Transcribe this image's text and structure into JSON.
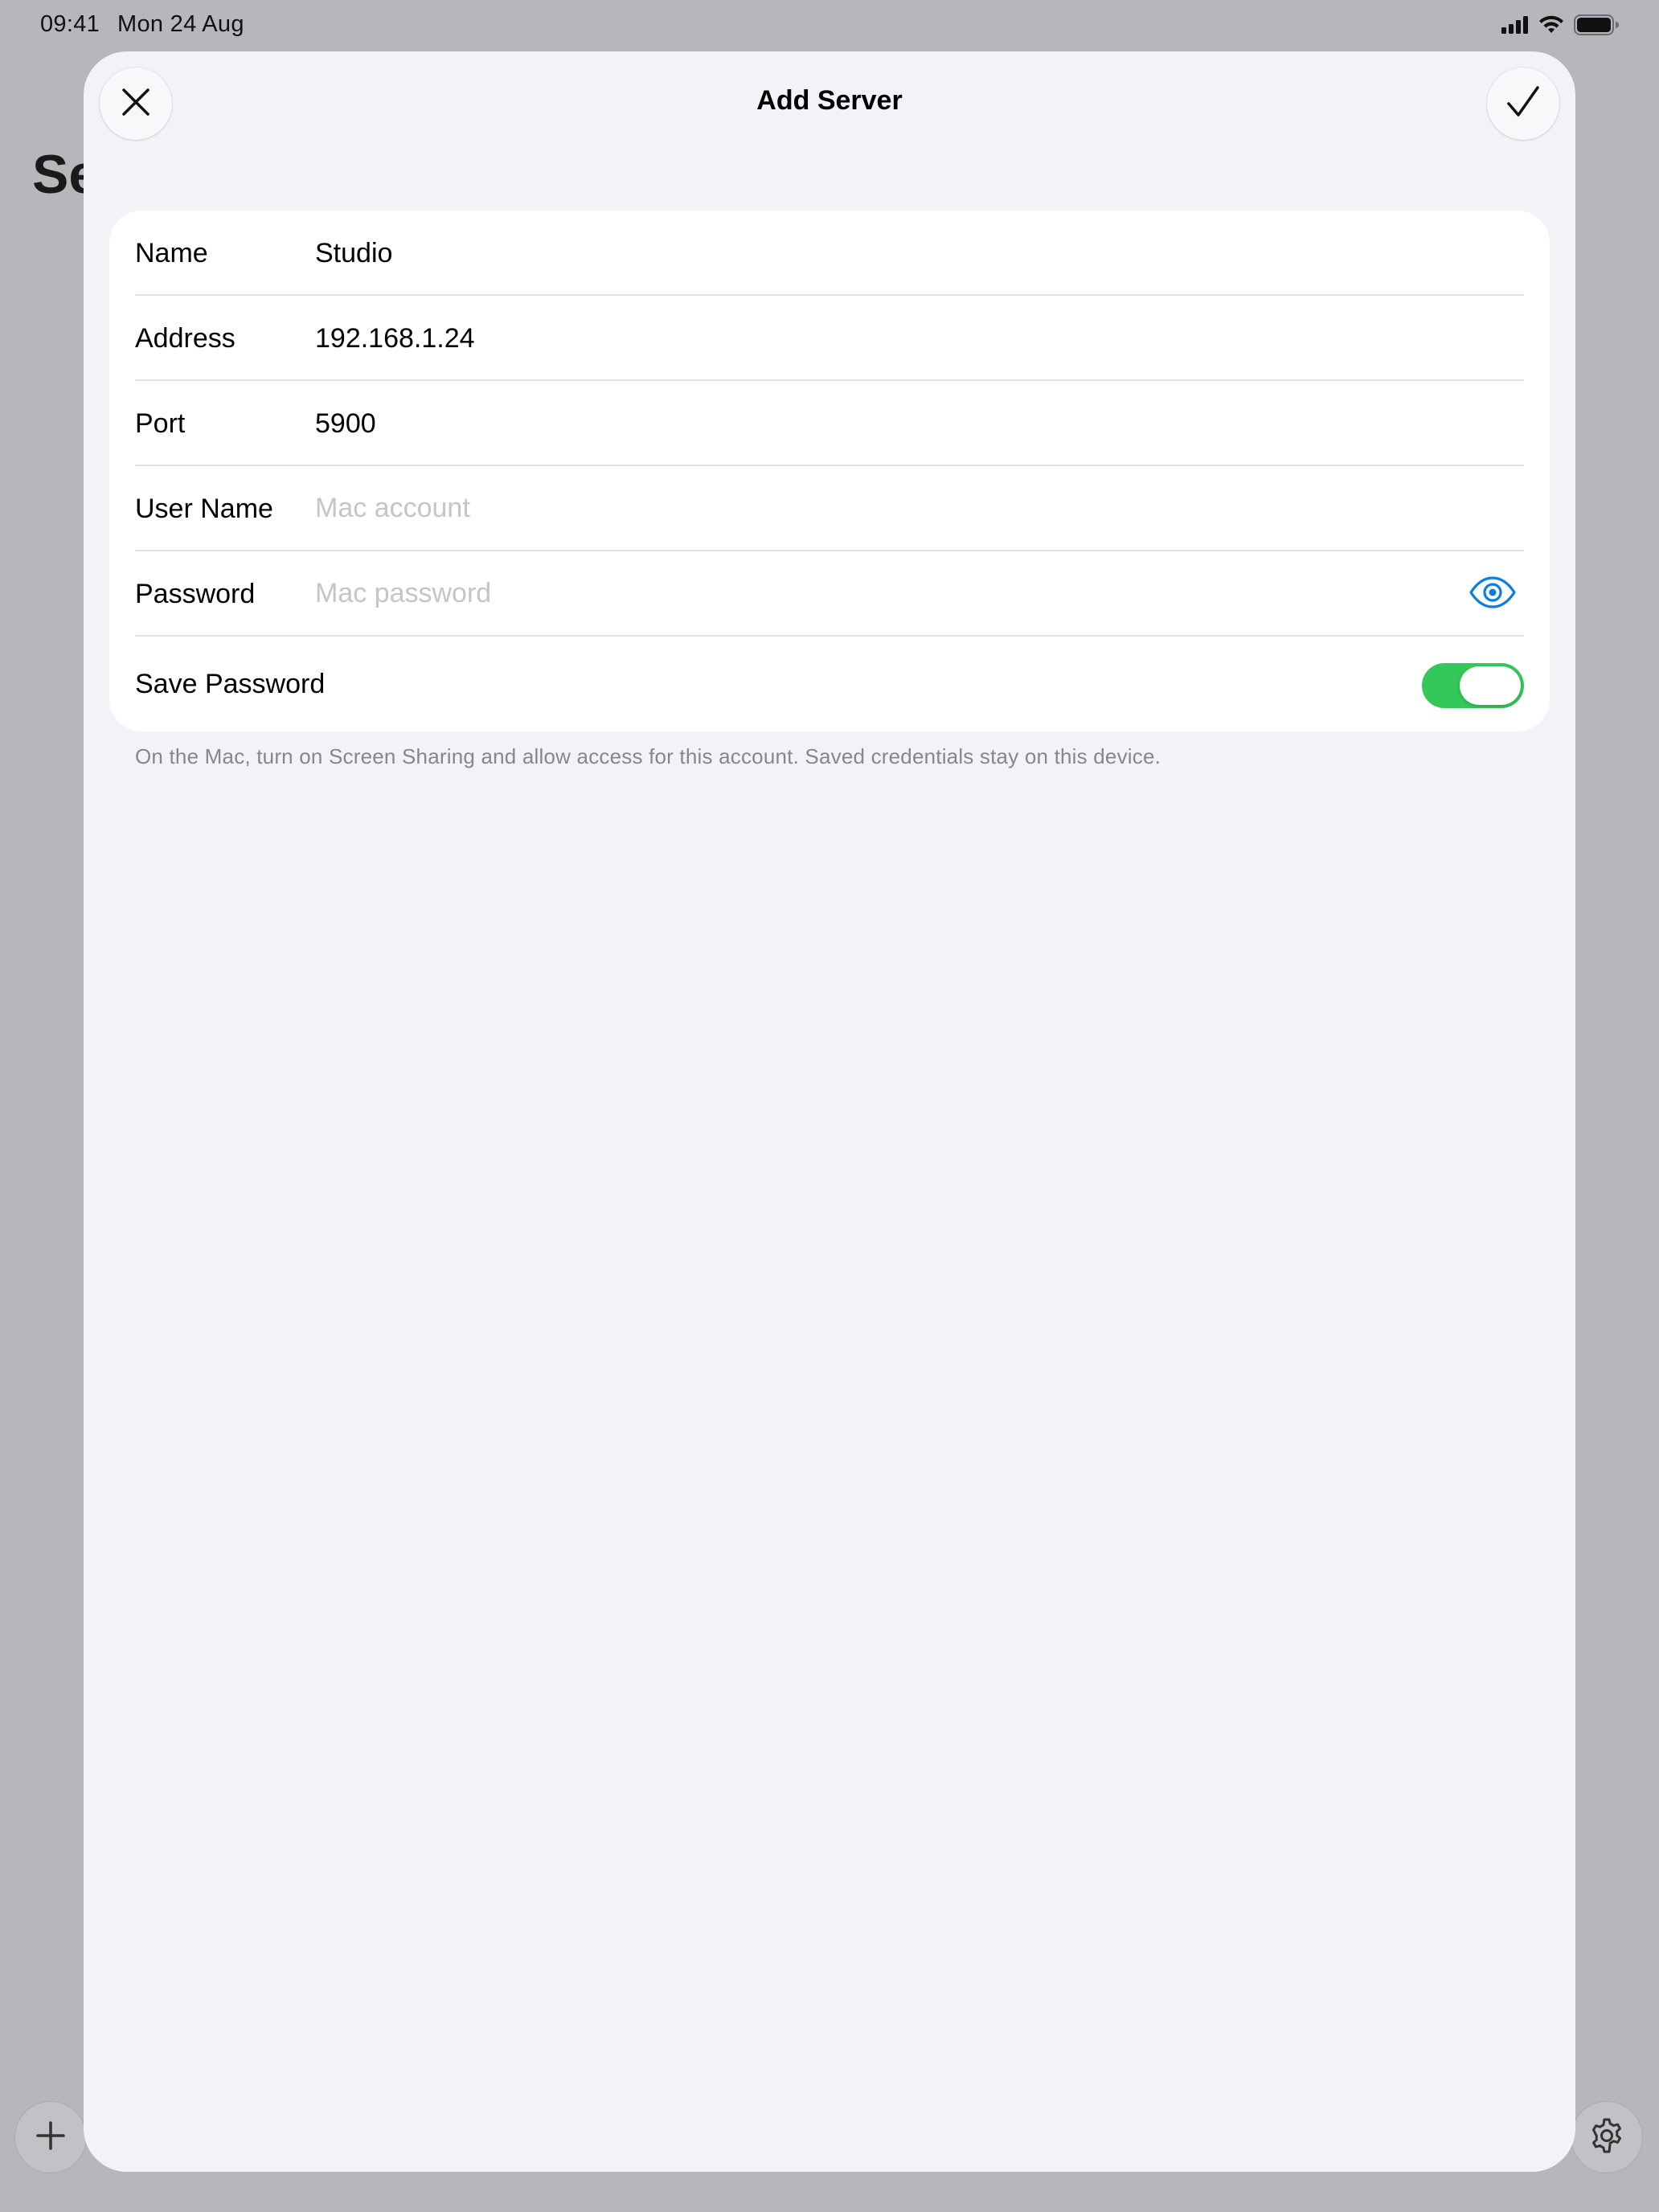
{
  "status_bar": {
    "time": "09:41",
    "date": "Mon 24 Aug",
    "icons": [
      "cellular-signal-icon",
      "wifi-icon",
      "battery-icon"
    ]
  },
  "background": {
    "title": "Se",
    "add_button_icon": "plus-icon",
    "settings_button_icon": "gear-icon"
  },
  "sheet": {
    "title": "Add Server",
    "cancel_icon": "close-icon",
    "done_icon": "checkmark-icon",
    "form": {
      "name": {
        "label": "Name",
        "value": "Studio"
      },
      "address": {
        "label": "Address",
        "value": "192.168.1.24"
      },
      "port": {
        "label": "Port",
        "value": "5900"
      },
      "username": {
        "label": "User Name",
        "value": "",
        "placeholder": "Mac account"
      },
      "password": {
        "label": "Password",
        "value": "",
        "placeholder": "Mac password",
        "reveal_icon": "eye-icon"
      },
      "save_password": {
        "label": "Save Password",
        "enabled": true
      }
    },
    "footnote": "On the Mac, turn on Screen Sharing and allow access for this account. Saved credentials stay on this device."
  },
  "colors": {
    "accent": "#0a7fe0",
    "toggle_on": "#34c759",
    "sheet_background": "#f2f2f7",
    "dimmed_background": "#b6b7bb",
    "placeholder": "#c5c5c8",
    "footnote": "#86868b"
  }
}
